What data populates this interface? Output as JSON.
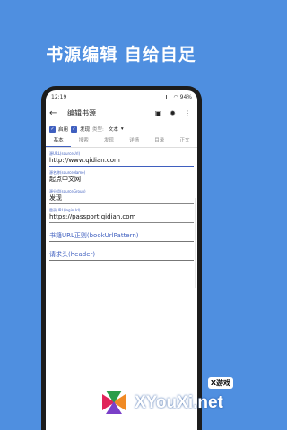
{
  "headline": "书源编辑  自给自足",
  "status": {
    "time": "12:19",
    "battery": "94%"
  },
  "appbar": {
    "title": "编辑书源"
  },
  "options": {
    "enable_label": "启用",
    "discover_label": "发现",
    "type_label": "类型:",
    "type_value": "文本"
  },
  "tabs": [
    "基本",
    "搜索",
    "发现",
    "详情",
    "目录",
    "正文"
  ],
  "fields": [
    {
      "label": "源URL(sourceUrl)",
      "value": "http://www.qidian.com"
    },
    {
      "label": "源名称(sourceName)",
      "value": "起点中文网"
    },
    {
      "label": "源分组(sourceGroup)",
      "value": "发现"
    },
    {
      "label": "登录URL(loginUrl)",
      "value": "https://passport.qidian.com"
    }
  ],
  "hints": [
    "书籍URL正则(bookUrlPattern)",
    "请求头(header)"
  ],
  "watermark": {
    "brand": "XYouXi.net",
    "tag": "X游戏"
  }
}
